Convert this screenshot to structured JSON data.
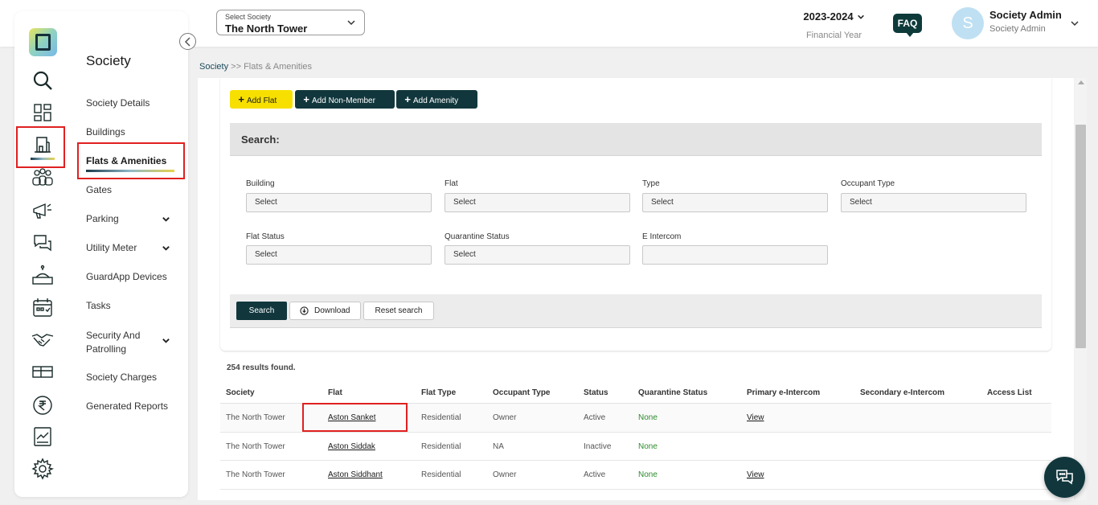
{
  "header": {
    "society_select_label": "Select Society",
    "society_select_value": "The North Tower",
    "financial_year": "2023-2024",
    "financial_year_label": "Financial Year",
    "faq_label": "FAQ",
    "user_initial": "S",
    "user_name": "Society Admin",
    "user_role": "Society Admin"
  },
  "sidebar": {
    "title": "Society",
    "items": [
      {
        "label": "Society Details",
        "has_submenu": false
      },
      {
        "label": "Buildings",
        "has_submenu": false
      },
      {
        "label": "Flats & Amenities",
        "has_submenu": false,
        "active": true
      },
      {
        "label": "Gates",
        "has_submenu": false
      },
      {
        "label": "Parking",
        "has_submenu": true
      },
      {
        "label": "Utility Meter",
        "has_submenu": true
      },
      {
        "label": "GuardApp Devices",
        "has_submenu": false
      },
      {
        "label": "Tasks",
        "has_submenu": false
      },
      {
        "label": "Security And Patrolling",
        "has_submenu": true
      },
      {
        "label": "Society Charges",
        "has_submenu": false
      },
      {
        "label": "Generated Reports",
        "has_submenu": false
      }
    ],
    "rail_icons": [
      "search-icon",
      "dashboard-grid-icon",
      "building-icon",
      "members-icon",
      "megaphone-icon",
      "chat-icon",
      "helpdesk-icon",
      "calendar-icon",
      "handshake-icon",
      "gift-icon",
      "rupee-icon",
      "report-icon",
      "settings-icon"
    ]
  },
  "breadcrumb": {
    "root": "Society",
    "separator": ">>",
    "current": "Flats & Amenities"
  },
  "actions": {
    "add_flat": "Add Flat",
    "add_non_member": "Add Non-Member",
    "add_amenity": "Add Amenity"
  },
  "search": {
    "title": "Search:",
    "fields": [
      {
        "label": "Building",
        "value": "Select"
      },
      {
        "label": "Flat",
        "value": "Select"
      },
      {
        "label": "Type",
        "value": "Select"
      },
      {
        "label": "Occupant Type",
        "value": "Select"
      },
      {
        "label": "Flat Status",
        "value": "Select"
      },
      {
        "label": "Quarantine Status",
        "value": "Select"
      },
      {
        "label": "E Intercom",
        "value": ""
      }
    ],
    "search_button": "Search",
    "download_button": "Download",
    "reset_button": "Reset search"
  },
  "results": {
    "count_text": "254 results found.",
    "columns": [
      "Society",
      "Flat",
      "Flat Type",
      "Occupant Type",
      "Status",
      "Quarantine Status",
      "Primary e-Intercom",
      "Secondary e-Intercom",
      "Access List"
    ],
    "rows": [
      {
        "society": "The North Tower",
        "flat": "Aston Sanket",
        "flat_type": "Residential",
        "occupant_type": "Owner",
        "status": "Active",
        "quarantine": "None",
        "primary": "View",
        "secondary": "",
        "access": ""
      },
      {
        "society": "The North Tower",
        "flat": "Aston Siddak",
        "flat_type": "Residential",
        "occupant_type": "NA",
        "status": "Inactive",
        "quarantine": "None",
        "primary": "",
        "secondary": "",
        "access": ""
      },
      {
        "society": "The North Tower",
        "flat": "Aston Siddhant",
        "flat_type": "Residential",
        "occupant_type": "Owner",
        "status": "Active",
        "quarantine": "None",
        "primary": "View",
        "secondary": "",
        "access": ""
      }
    ]
  },
  "colors": {
    "brand_dark": "#11373d",
    "accent_yellow": "#f7e000",
    "highlight_red": "#e02020",
    "status_green": "#2e8b2e"
  }
}
